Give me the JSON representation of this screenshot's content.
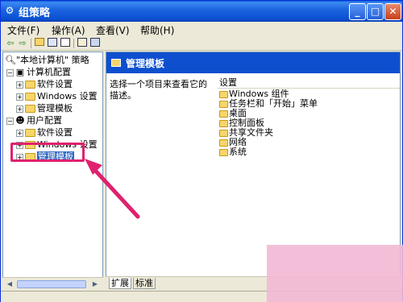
{
  "window": {
    "title": "组策略",
    "title_icon": "group-policy-icon",
    "controls": {
      "minimize": "_",
      "maximize": "□",
      "close": "✕"
    }
  },
  "menubar": {
    "items": [
      {
        "label": "文件(F)"
      },
      {
        "label": "操作(A)"
      },
      {
        "label": "查看(V)"
      },
      {
        "label": "帮助(H)"
      }
    ]
  },
  "toolbar": {
    "icons": [
      "back-arrow-icon",
      "forward-arrow-icon",
      "up-folder-icon",
      "show-tree-icon",
      "export-list-icon",
      "properties-icon",
      "help-icon"
    ]
  },
  "tree": {
    "root": "\"本地计算机\" 策略",
    "nodes": [
      {
        "label": "计算机配置",
        "level": 1,
        "expanded": true,
        "icon": "computer-icon"
      },
      {
        "label": "软件设置",
        "level": 2,
        "icon": "folder-icon"
      },
      {
        "label": "Windows 设置",
        "level": 2,
        "icon": "folder-icon"
      },
      {
        "label": "管理模板",
        "level": 2,
        "icon": "folder-icon"
      },
      {
        "label": "用户配置",
        "level": 1,
        "expanded": true,
        "icon": "user-icon"
      },
      {
        "label": "软件设置",
        "level": 2,
        "icon": "folder-icon"
      },
      {
        "label": "Windows 设置",
        "level": 2,
        "icon": "folder-icon"
      },
      {
        "label": "管理模板",
        "level": 2,
        "icon": "folder-icon",
        "selected": true
      }
    ]
  },
  "rightpane": {
    "header": "管理模板",
    "description": "选择一个项目来查看它的描述。",
    "column_header": "设置",
    "items": [
      "Windows 组件",
      "任务栏和「开始」菜单",
      "桌面",
      "控制面板",
      "共享文件夹",
      "网络",
      "系统"
    ]
  },
  "tabs": [
    {
      "label": "扩展",
      "active": true
    },
    {
      "label": "标准",
      "active": false
    }
  ],
  "colors": {
    "titlebar": "#0a5fd8",
    "header": "#0e4fcf",
    "selection": "#316ac5",
    "annotation": "#e0216e"
  }
}
